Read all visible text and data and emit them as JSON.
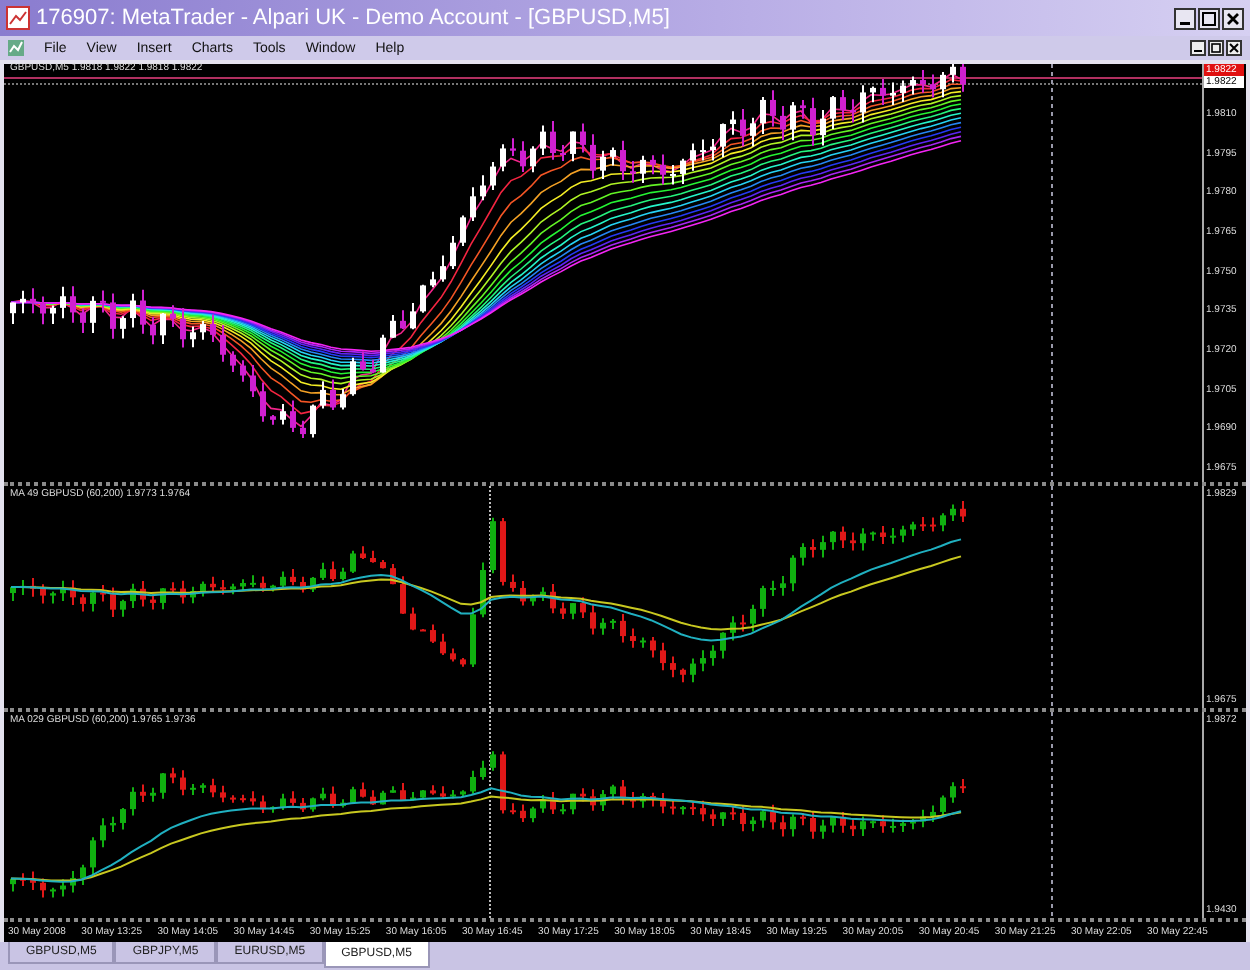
{
  "window": {
    "title": "176907: MetaTrader - Alpari UK - Demo Account - [GBPUSD,M5]"
  },
  "menu": [
    "File",
    "View",
    "Insert",
    "Charts",
    "Tools",
    "Window",
    "Help"
  ],
  "main_chart": {
    "legend": "GBPUSD,M5  1.9818 1.9822 1.9818 1.9822",
    "tags": [
      {
        "text": "1.9822",
        "kind": "bid"
      },
      {
        "text": "1.9822",
        "kind": "current"
      }
    ],
    "price_axis": [
      "1.9810",
      "1.9795",
      "1.9780",
      "1.9765",
      "1.9750",
      "1.9735",
      "1.9720",
      "1.9705",
      "1.9690",
      "1.9675"
    ]
  },
  "indicator_panes": [
    {
      "legend": "MA 49 GBPUSD (60,200) 1.9773 1.9764",
      "price_axis": [
        "1.9829",
        "1.9675"
      ]
    },
    {
      "legend": "MA 029 GBPUSD (60,200) 1.9765 1.9736",
      "price_axis": [
        "1.9872",
        "1.9430"
      ]
    }
  ],
  "time_axis": [
    "30 May 2008",
    "30 May 13:25",
    "30 May 14:05",
    "30 May 14:45",
    "30 May 15:25",
    "30 May 16:05",
    "30 May 16:45",
    "30 May 17:25",
    "30 May 18:05",
    "30 May 18:45",
    "30 May 19:25",
    "30 May 20:05",
    "30 May 20:45",
    "30 May 21:25",
    "30 May 22:05",
    "30 May 22:45"
  ],
  "tabs": [
    {
      "label": "GBPUSD,M5",
      "selected": false
    },
    {
      "label": "GBPJPY,M5",
      "selected": false
    },
    {
      "label": "EURUSD,M5",
      "selected": false
    },
    {
      "label": "GBPUSD,M5",
      "selected": true
    }
  ]
}
